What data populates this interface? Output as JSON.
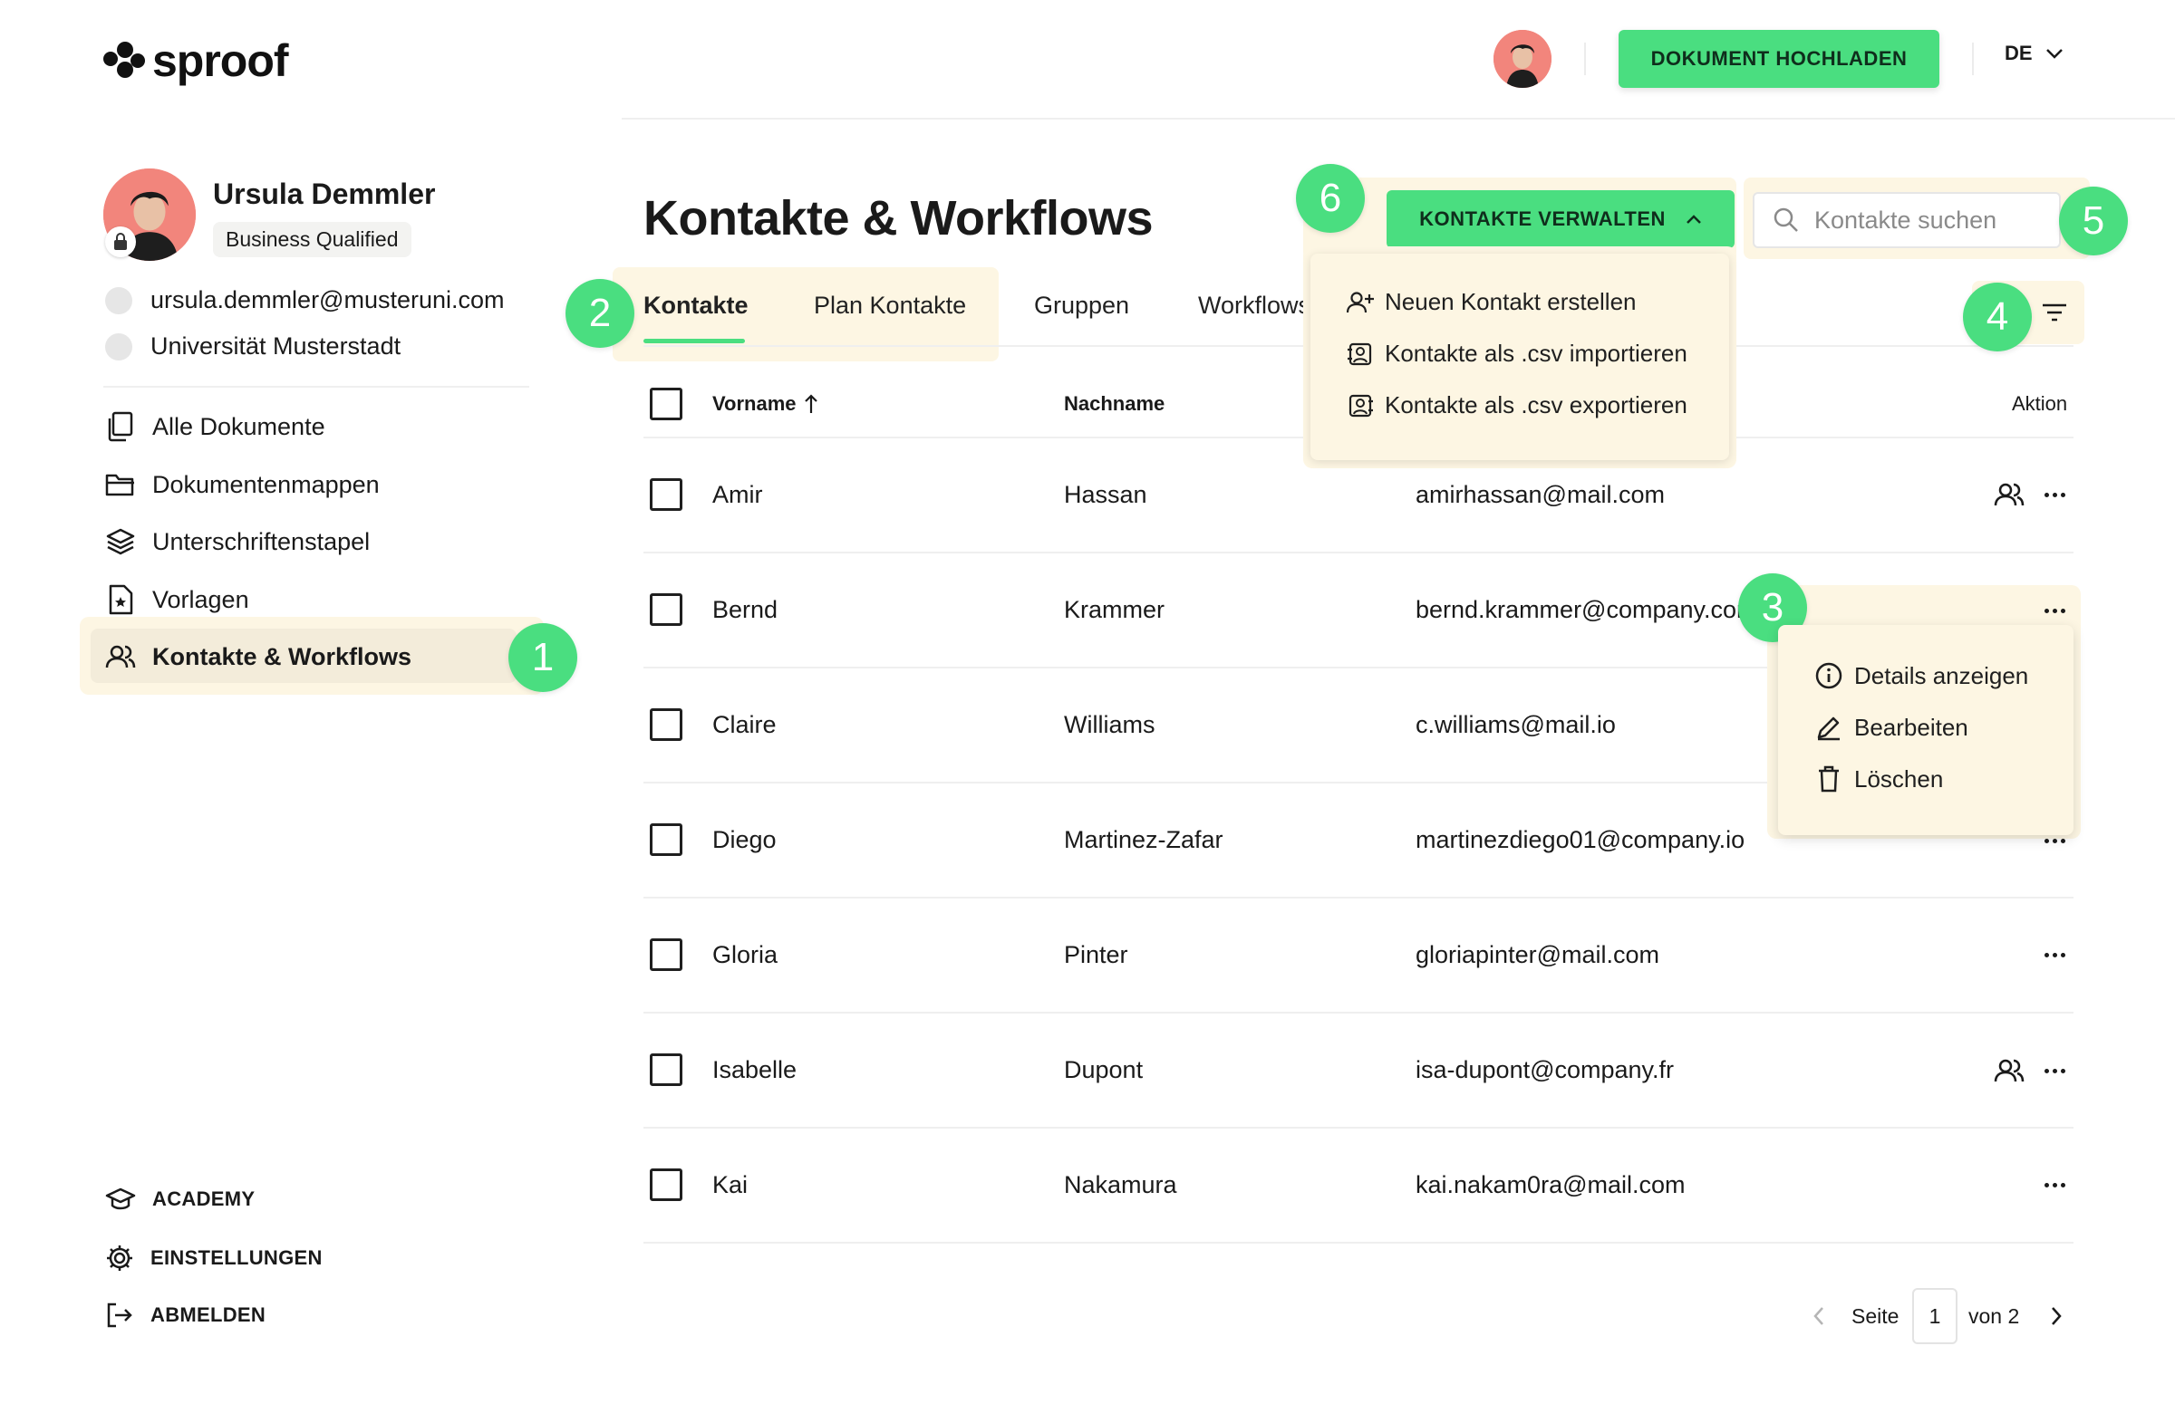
{
  "brand": {
    "logo_text": "sproof"
  },
  "header": {
    "upload_label": "DOKUMENT HOCHLADEN",
    "language": "DE"
  },
  "sidebar": {
    "profile": {
      "name": "Ursula Demmler",
      "badge": "Business Qualified",
      "email": "ursula.demmler@musteruni.com",
      "organization": "Universität Musterstadt"
    },
    "nav": [
      {
        "label": "Alle Dokumente",
        "icon": "documents-icon"
      },
      {
        "label": "Dokumentenmappen",
        "icon": "folder-icon"
      },
      {
        "label": "Unterschriftenstapel",
        "icon": "stack-icon"
      },
      {
        "label": "Vorlagen",
        "icon": "template-icon"
      },
      {
        "label": "Kontakte & Workflows",
        "icon": "contacts-icon",
        "active": true
      }
    ],
    "bottom": [
      {
        "label": "ACADEMY",
        "icon": "academy-icon"
      },
      {
        "label": "EINSTELLUNGEN",
        "icon": "gear-icon"
      },
      {
        "label": "ABMELDEN",
        "icon": "logout-icon"
      }
    ]
  },
  "main": {
    "title": "Kontakte & Workflows",
    "manage_label": "KONTAKTE VERWALTEN",
    "search_placeholder": "Kontakte suchen",
    "tabs": [
      "Kontakte",
      "Plan Kontakte",
      "Gruppen",
      "Workflows"
    ],
    "columns": {
      "first": "Vorname",
      "last": "Nachname",
      "action": "Aktion"
    },
    "rows": [
      {
        "first": "Amir",
        "last": "Hassan",
        "email": "amirhassan@mail.com",
        "group_icon": true
      },
      {
        "first": "Bernd",
        "last": "Krammer",
        "email": "bernd.krammer@company.com",
        "group_icon": false
      },
      {
        "first": "Claire",
        "last": "Williams",
        "email": "c.williams@mail.io",
        "group_icon": false
      },
      {
        "first": "Diego",
        "last": "Martinez-Zafar",
        "email": "martinezdiego01@company.io",
        "group_icon": false
      },
      {
        "first": "Gloria",
        "last": "Pinter",
        "email": "gloriapinter@mail.com",
        "group_icon": false
      },
      {
        "first": "Isabelle",
        "last": "Dupont",
        "email": "isa-dupont@company.fr",
        "group_icon": true
      },
      {
        "first": "Kai",
        "last": "Nakamura",
        "email": "kai.nakam0ra@mail.com",
        "group_icon": false
      }
    ],
    "manage_menu": [
      "Neuen Kontakt erstellen",
      "Kontakte als .csv importieren",
      "Kontakte als .csv exportieren"
    ],
    "row_menu": [
      "Details anzeigen",
      "Bearbeiten",
      "Löschen"
    ],
    "pagination": {
      "label": "Seite",
      "current": "1",
      "of_label": "von 2"
    }
  },
  "annotations": [
    "1",
    "2",
    "3",
    "4",
    "5",
    "6"
  ],
  "colors": {
    "accent": "#4ade80",
    "highlight": "#fdf6e3",
    "avatar_bg": "#f2857c"
  }
}
